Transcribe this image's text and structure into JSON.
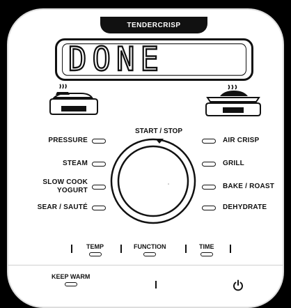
{
  "brand": "TENDERCRISP",
  "display": {
    "text": "DONE"
  },
  "start_stop": "START / STOP",
  "left_functions": [
    "PRESSURE",
    "STEAM",
    "SLOW COOK\nYOGURT",
    "SEAR / SAUTÉ"
  ],
  "right_functions": [
    "AIR CRISP",
    "GRILL",
    "BAKE / ROAST",
    "DEHYDRATE"
  ],
  "controls": {
    "temp": "TEMP",
    "function": "FUNCTION",
    "time": "TIME",
    "keep_warm": "KEEP WARM"
  },
  "icons": {
    "pressure_lid": "pressure-lid-icon",
    "crisping_lid": "crisping-lid-icon",
    "power": "power-icon"
  }
}
